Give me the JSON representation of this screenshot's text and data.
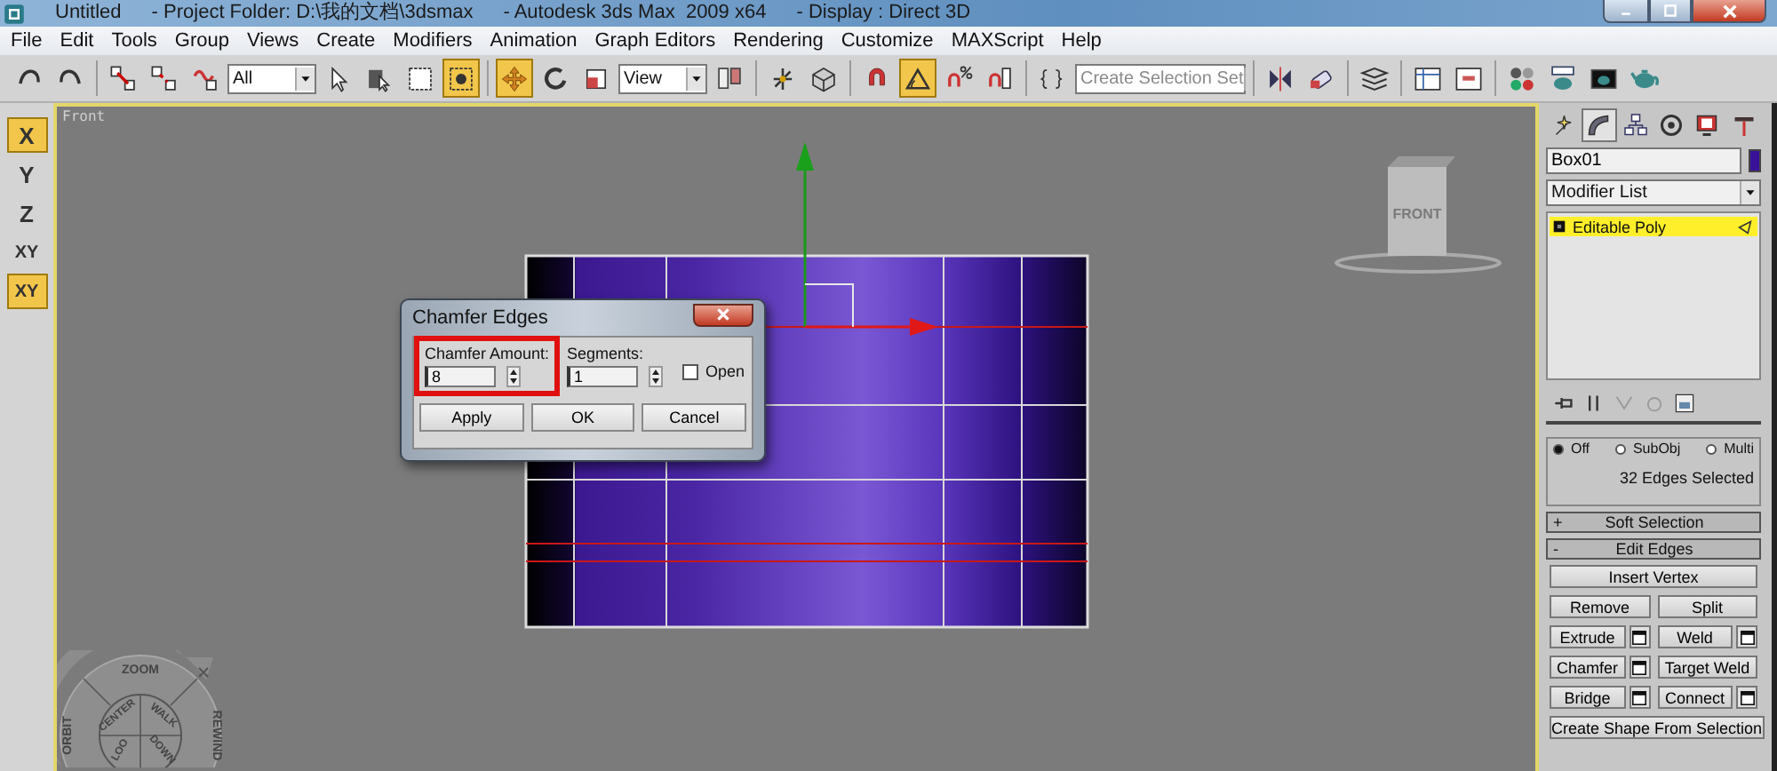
{
  "window": {
    "title_parts": [
      "Untitled",
      "- Project Folder: D:\\我的文档\\3dsmax",
      "- Autodesk 3ds Max  2009 x64",
      "- Display : Direct 3D"
    ]
  },
  "menu": [
    "File",
    "Edit",
    "Tools",
    "Group",
    "Views",
    "Create",
    "Modifiers",
    "Animation",
    "Graph Editors",
    "Rendering",
    "Customize",
    "MAXScript",
    "Help"
  ],
  "toolbar": [
    {
      "kind": "button",
      "selected": false
    },
    {
      "kind": "button",
      "selected": false
    },
    {
      "kind": "separator"
    },
    {
      "kind": "button",
      "selected": false
    },
    {
      "kind": "button",
      "selected": false
    },
    {
      "kind": "button",
      "selected": false
    },
    {
      "kind": "dropdown",
      "value": "All"
    },
    {
      "kind": "button",
      "selected": false
    },
    {
      "kind": "button",
      "selected": false
    },
    {
      "kind": "button",
      "selected": false
    },
    {
      "kind": "button",
      "selected": true
    },
    {
      "kind": "separator"
    },
    {
      "kind": "button",
      "selected": true
    },
    {
      "kind": "button",
      "selected": false
    },
    {
      "kind": "button",
      "selected": false
    },
    {
      "kind": "dropdown",
      "value": "View"
    },
    {
      "kind": "button",
      "selected": false
    },
    {
      "kind": "separator"
    },
    {
      "kind": "button",
      "selected": false
    },
    {
      "kind": "button",
      "selected": false
    },
    {
      "kind": "separator"
    },
    {
      "kind": "button",
      "selected": false
    },
    {
      "kind": "button",
      "selected": true
    },
    {
      "kind": "button",
      "selected": false
    },
    {
      "kind": "button",
      "selected": false
    },
    {
      "kind": "separator"
    },
    {
      "kind": "button",
      "selected": false
    },
    {
      "kind": "dropdown",
      "placeholder": "Create Selection Set"
    },
    {
      "kind": "separator"
    },
    {
      "kind": "button",
      "selected": false
    },
    {
      "kind": "button",
      "selected": false
    },
    {
      "kind": "separator"
    },
    {
      "kind": "button",
      "selected": false
    },
    {
      "kind": "separator"
    },
    {
      "kind": "button",
      "selected": false
    },
    {
      "kind": "button",
      "selected": false
    },
    {
      "kind": "separator"
    },
    {
      "kind": "button",
      "selected": false
    },
    {
      "kind": "button",
      "selected": false
    },
    {
      "kind": "button",
      "selected": false
    },
    {
      "kind": "button",
      "selected": false
    }
  ],
  "axis_constraints": [
    {
      "label": "X",
      "selected": true
    },
    {
      "label": "Y",
      "selected": false
    },
    {
      "label": "Z",
      "selected": false
    },
    {
      "label": "XY",
      "selected": false
    },
    {
      "label": "XY",
      "selected": true
    }
  ],
  "viewport": {
    "label": "Front",
    "viewcube": "FRONT",
    "wheel": [
      "ZOOM",
      "CENTER",
      "WALK",
      "REWIND",
      "ORBIT",
      "LOO",
      "DOWN"
    ]
  },
  "dialog": {
    "title": "Chamfer Edges",
    "fields": [
      {
        "label": "Chamfer Amount:",
        "value": "8",
        "highlighted": true
      },
      {
        "label": "Segments:",
        "value": "1",
        "highlighted": false
      }
    ],
    "open": {
      "label": "Open",
      "checked": false
    },
    "buttons": [
      "Apply",
      "OK",
      "Cancel"
    ]
  },
  "command_panel": {
    "tabs": [
      {
        "selected": false
      },
      {
        "selected": true
      },
      {
        "selected": false
      },
      {
        "selected": false
      },
      {
        "selected": false
      },
      {
        "selected": false
      }
    ],
    "object": {
      "name": "Box01",
      "color": "#3a129a"
    },
    "modifier_list": "Modifier List",
    "stack": [
      {
        "label": "Editable Poly",
        "selected": true
      }
    ],
    "selection_level": [
      {
        "label": "Off",
        "selected": true
      },
      {
        "label": "SubObj",
        "selected": false
      },
      {
        "label": "Multi",
        "selected": false
      }
    ],
    "selection_info": "32 Edges Selected",
    "rollouts": [
      {
        "sign": "+",
        "title": "Soft Selection"
      },
      {
        "sign": "-",
        "title": "Edit Edges"
      }
    ],
    "buttons": [
      {
        "label": "Insert Vertex",
        "kind": "wide"
      },
      {
        "label": "Remove",
        "kind": "plain"
      },
      {
        "label": "Split",
        "kind": "plain"
      },
      {
        "label": "Extrude",
        "kind": "settings"
      },
      {
        "label": "Weld",
        "kind": "settings"
      },
      {
        "label": "Chamfer",
        "kind": "settings"
      },
      {
        "label": "Target Weld",
        "kind": "plain"
      },
      {
        "label": "Bridge",
        "kind": "settings"
      },
      {
        "label": "Connect",
        "kind": "settings"
      },
      {
        "label": "Create Shape From Selection",
        "kind": "wide"
      }
    ]
  }
}
